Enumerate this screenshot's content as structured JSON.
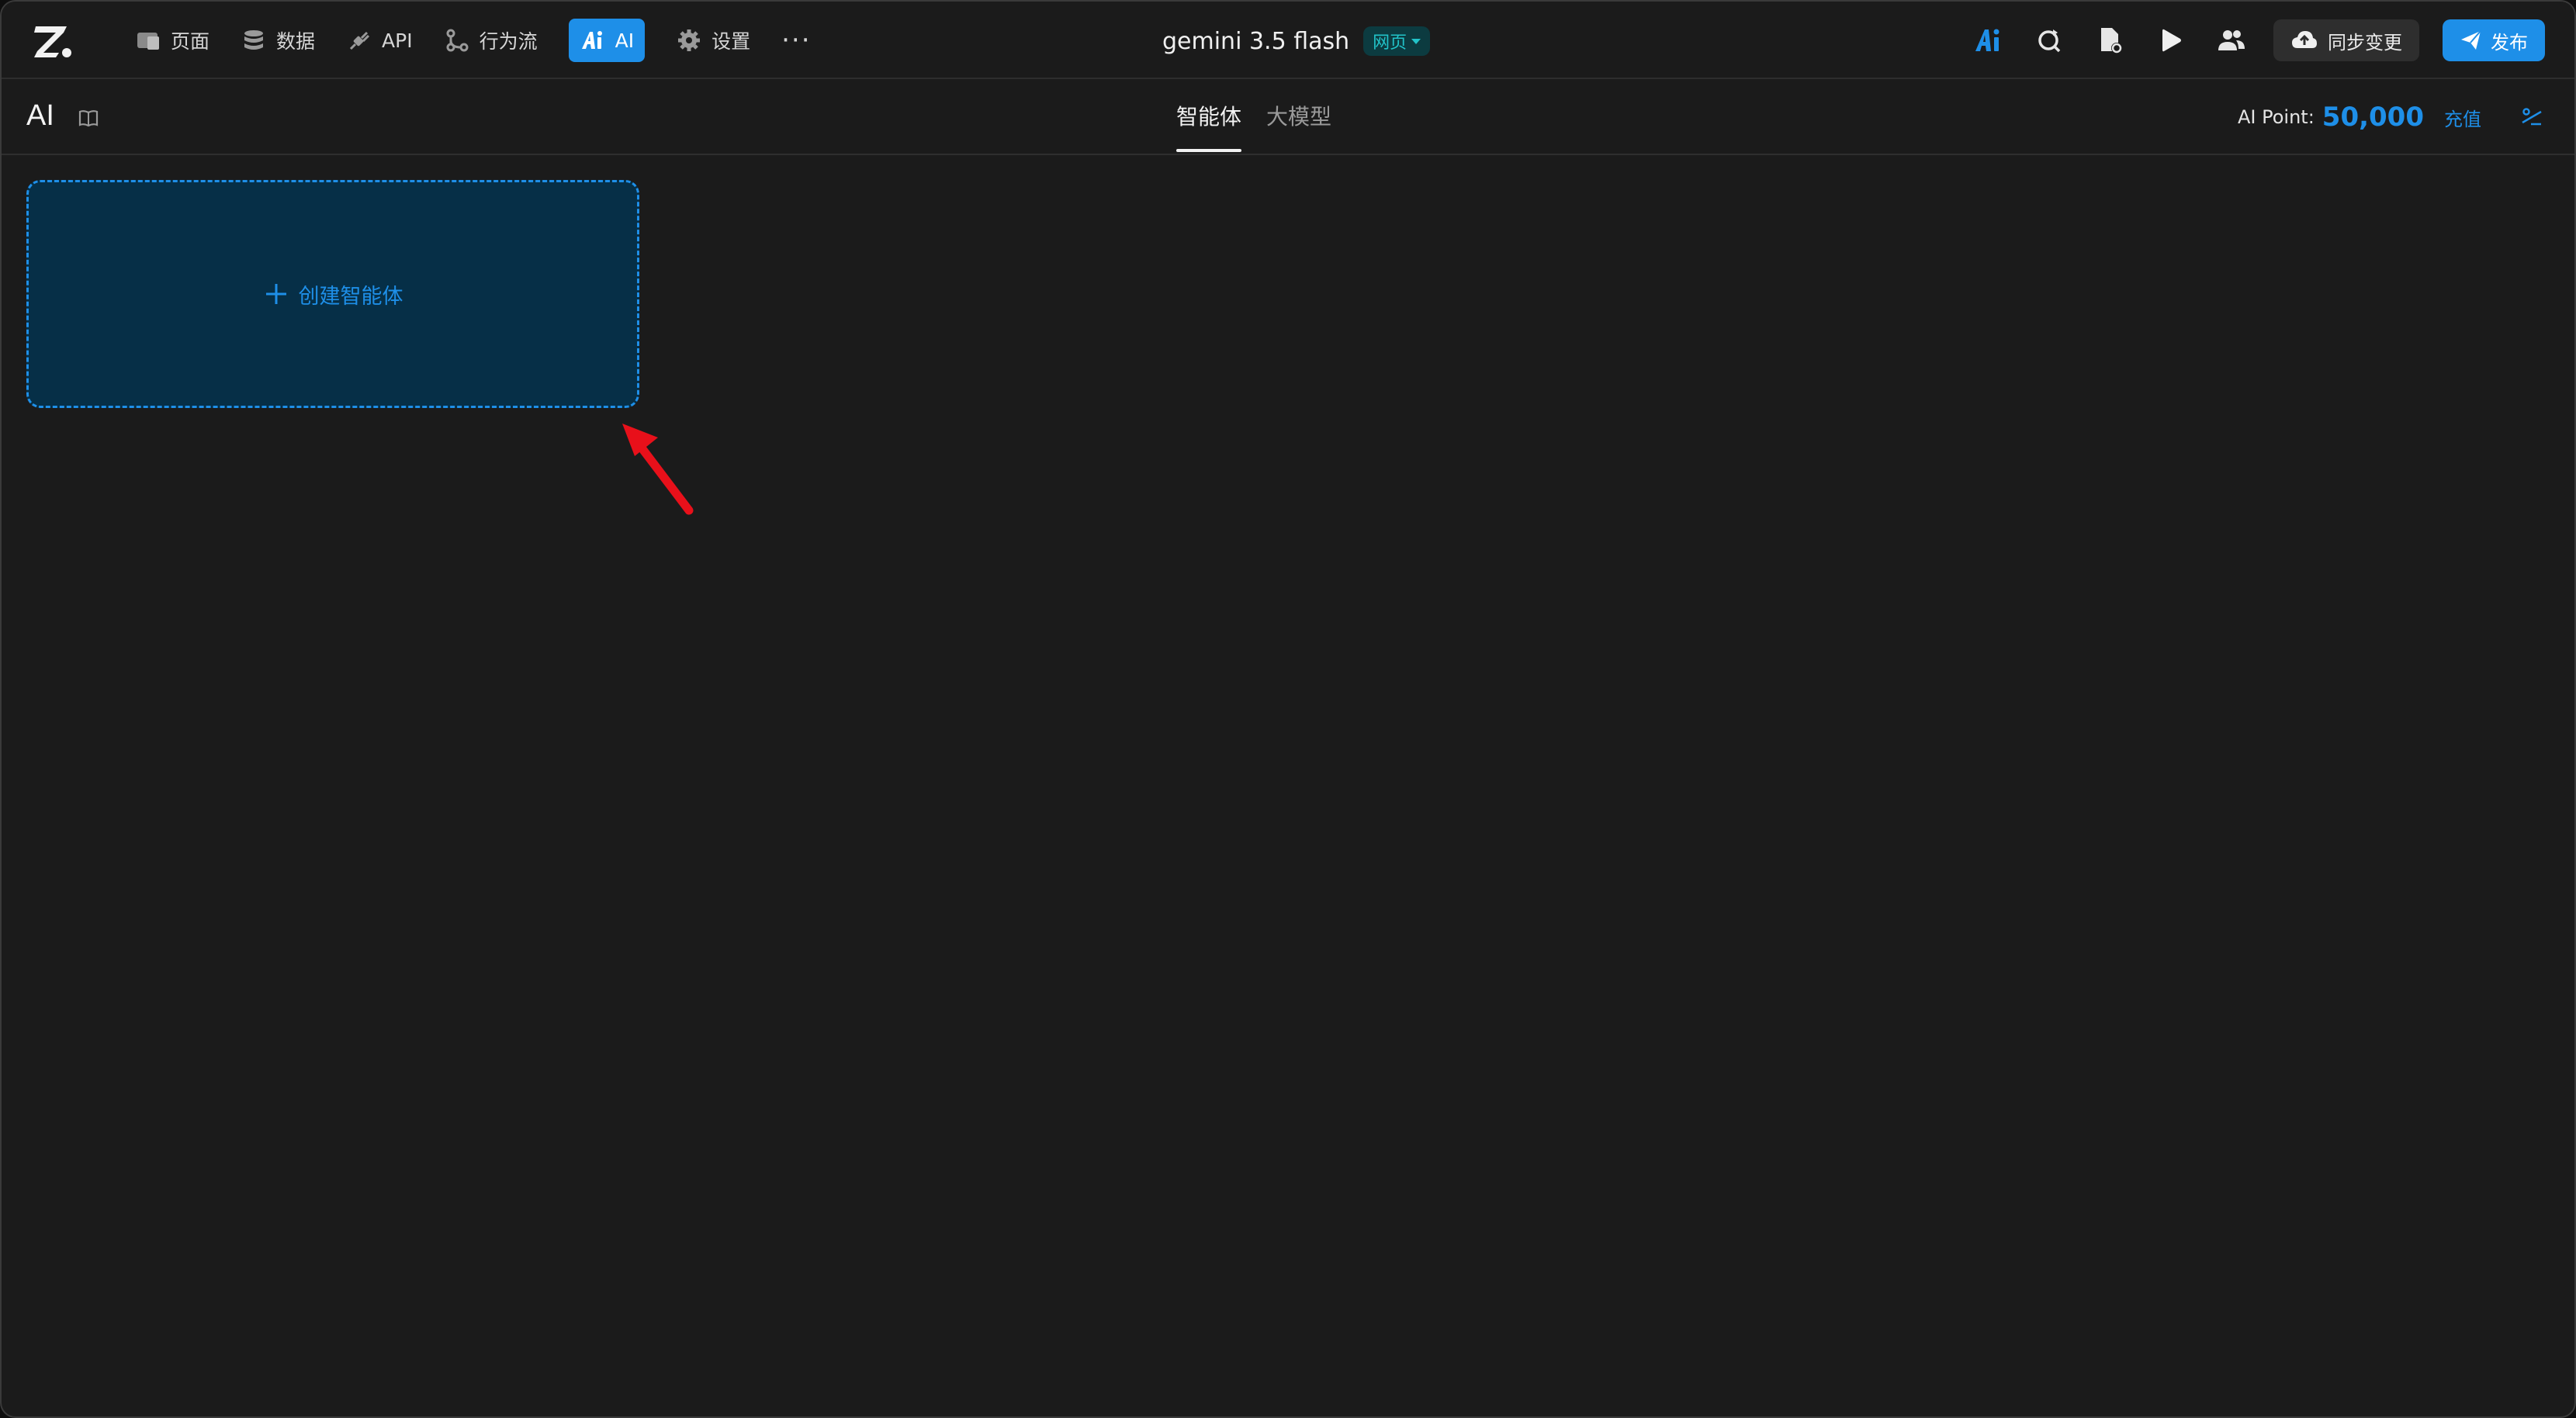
{
  "topbar": {
    "nav": [
      {
        "label": "页面",
        "icon": "pages-icon"
      },
      {
        "label": "数据",
        "icon": "database-icon"
      },
      {
        "label": "API",
        "icon": "api-plug-icon"
      },
      {
        "label": "行为流",
        "icon": "workflow-icon"
      },
      {
        "label": "AI",
        "icon": "ai-icon",
        "active": true
      },
      {
        "label": "设置",
        "icon": "gear-icon"
      }
    ],
    "more_label": "···",
    "app_title": "gemini 3.5 flash",
    "mode_badge": "网页",
    "sync_label": "同步变更",
    "publish_label": "发布"
  },
  "subbar": {
    "section_title": "AI",
    "tabs": [
      {
        "label": "智能体",
        "active": true
      },
      {
        "label": "大模型",
        "active": false
      }
    ],
    "points_label": "AI Point:",
    "points_value": "50,000",
    "recharge_label": "充值"
  },
  "main": {
    "create_label": "创建智能体"
  },
  "colors": {
    "accent": "#1e8fe8",
    "background": "#1b1b1b",
    "card_background": "#062f47",
    "badge_text": "#22c3c9",
    "annotation_arrow": "#e8101a"
  }
}
